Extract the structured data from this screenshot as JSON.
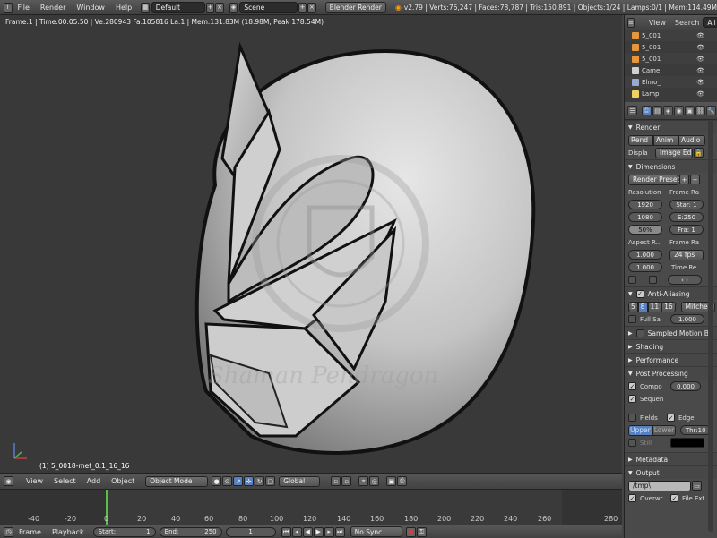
{
  "topbar": {
    "menus": [
      "File",
      "Render",
      "Window",
      "Help"
    ],
    "layout": "Default",
    "scene": "Scene",
    "engine": "Blender Render",
    "stats": "v2.79 | Verts:76,247 | Faces:78,787 | Tris:150,891 | Objects:1/24 | Lamps:0/1 | Mem:114.49M"
  },
  "viewport": {
    "info": "Frame:1 | Time:00:05.50 | Ve:280943 Fa:105816 La:1 | Mem:131.83M (18.98M, Peak 178.54M)",
    "object_label": "(1) 5_0018-met_0.1_16_16",
    "watermark_text": "Shaman Pendragon"
  },
  "view3d_header": {
    "menus": [
      "View",
      "Select",
      "Add",
      "Object"
    ],
    "mode": "Object Mode",
    "orientation": "Global"
  },
  "timeline": {
    "ticks": [
      "-40",
      "-20",
      "0",
      "20",
      "40",
      "60",
      "80",
      "100",
      "120",
      "140",
      "160",
      "180",
      "200",
      "220",
      "240",
      "260",
      "280"
    ],
    "menus": [
      "Frame",
      "Playback"
    ],
    "start_label": "Start:",
    "start_value": "1",
    "end_label": "End:",
    "end_value": "250",
    "current": "1",
    "sync": "No Sync"
  },
  "outliner": {
    "tabs": [
      "View",
      "Search",
      "All"
    ],
    "items": [
      {
        "name": "5_001",
        "color": "#e8963a"
      },
      {
        "name": "5_001",
        "color": "#e8963a"
      },
      {
        "name": "5_001",
        "color": "#e8963a"
      },
      {
        "name": "Came",
        "color": "#d0d0d0"
      },
      {
        "name": "Elmo_",
        "color": "#9ac"
      },
      {
        "name": "Lamp",
        "color": "#f0d060"
      }
    ]
  },
  "properties": {
    "render_panel": "Render",
    "render_btn": "Rend",
    "anim_btn": "Anim",
    "audio_btn": "Audio",
    "display_label": "Displa",
    "display_value": "Image Ed",
    "dimensions_panel": "Dimensions",
    "render_presets": "Render Presets",
    "resolution_label": "Resolution",
    "res_x": "1920",
    "res_y": "1080",
    "res_pct": "50%",
    "frame_range_label": "Frame Ra",
    "frame_start": "Star: 1",
    "frame_end": "E:250",
    "frame_step": "Fra: 1",
    "aspect_label": "Aspect R...",
    "aspect_x": "1.000",
    "aspect_y": "1.000",
    "fps_label": "Frame Ra",
    "fps": "24 fps",
    "time_remap": "Time Re...",
    "aa_panel": "Anti-Aliasing",
    "aa_samples": [
      "5",
      "8",
      "11",
      "16"
    ],
    "aa_filter": "Mitchell-",
    "full_sample": "Full Sa",
    "aa_size": "1.000",
    "sampled_motion": "Sampled Motion Bl",
    "shading": "Shading",
    "performance": "Performance",
    "post_processing": "Post Processing",
    "compositing": "Compo",
    "comp_value": "0.000",
    "sequencer": "Sequen",
    "fields": "Fields",
    "edge": "Edge",
    "upper": "Upper",
    "lower": "Lower",
    "thr": "Thr:10",
    "still": "Still",
    "metadata": "Metadata",
    "output": "Output",
    "output_path": "/tmp\\",
    "overwrite": "Overwr",
    "file_ext": "File Ext"
  },
  "colors": {
    "bg": "#393939",
    "accent": "#5680c2",
    "timeline_cursor": "#59c046"
  }
}
